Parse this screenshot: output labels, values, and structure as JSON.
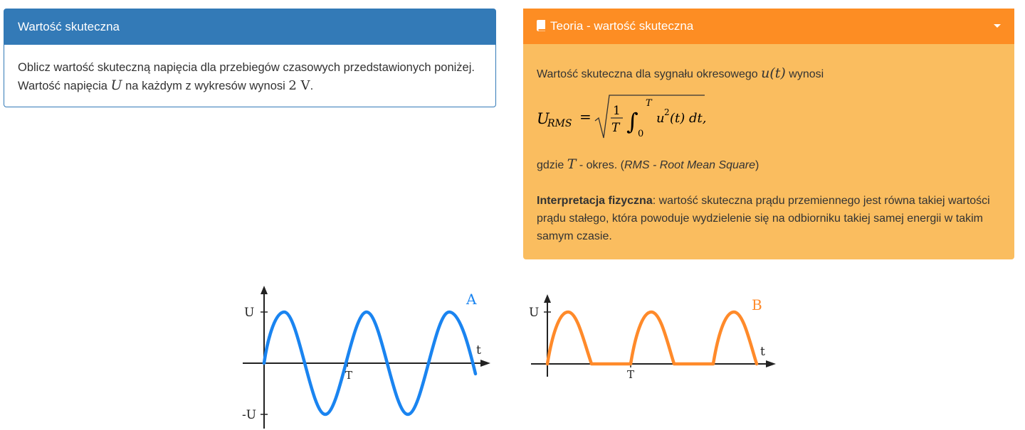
{
  "left_panel": {
    "title": "Wartość skuteczna",
    "text_1": "Oblicz wartość skuteczną napięcia dla przebiegów czasowych przedstawionych poniżej. Wartość napięcia ",
    "var_U": "U",
    "text_2": " na każdym z wykresów wynosi ",
    "value": "2 V",
    "text_3": "."
  },
  "right_panel": {
    "title": "Teoria - wartość skuteczna",
    "icon": "book-icon",
    "intro_text": "Wartość skuteczna dla sygnału okresowego ",
    "intro_var": "u(t)",
    "intro_text_2": " wynosi",
    "formula": {
      "lhs": "U",
      "lhs_sub": "RMS",
      "eq": "=",
      "numerator": "1",
      "denominator": "T",
      "upper": "T",
      "lower": "0",
      "integrand": "u",
      "power": "2",
      "rest": "(t) dt,"
    },
    "where_text": "gdzie ",
    "where_var": "T",
    "where_text_2": " - okres. (",
    "where_italic": "RMS - Root Mean Square",
    "where_close": ")",
    "interp_bold": "Interpretacja fizyczna",
    "interp_text": ": wartość skuteczna prądu przemiennego jest równa takiej wartości prądu stałego, która powoduje wydzielenie się na odbiorniku takiej samej energii w takim samym czasie."
  },
  "graph_a": {
    "label": "A",
    "color": "#1a84f0",
    "y_top": "U",
    "y_bottom": "-U",
    "x_label": "t",
    "tick_label": "T"
  },
  "graph_b": {
    "label": "B",
    "color": "#ff8a2a",
    "y_top": "U",
    "x_label": "t",
    "tick_label": "T"
  }
}
